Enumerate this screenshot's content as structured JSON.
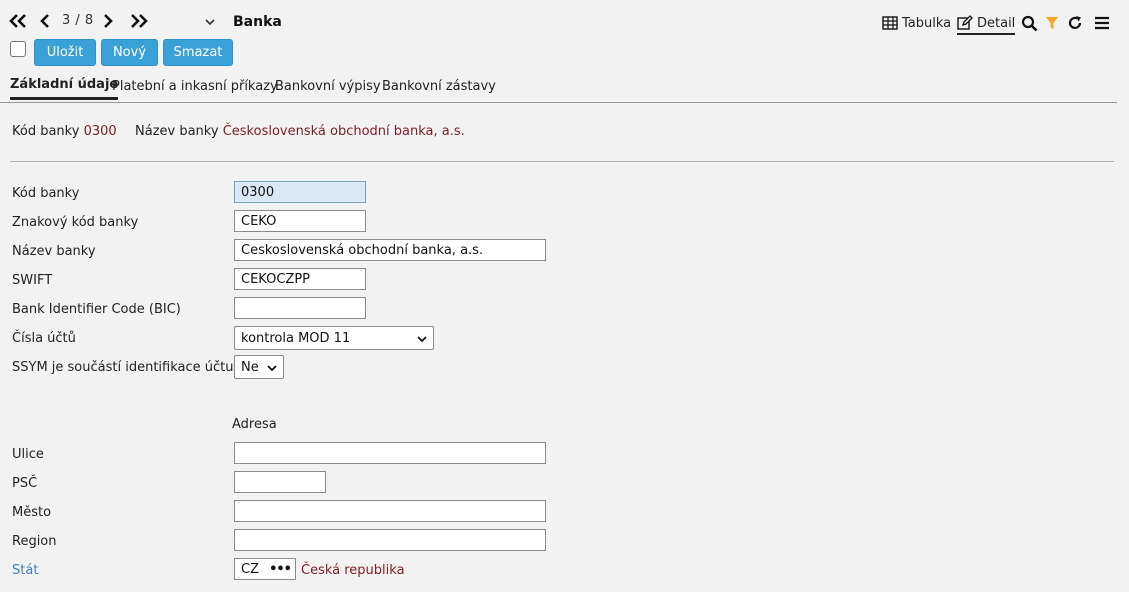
{
  "nav": {
    "position": "3 / 8",
    "title": "Banka"
  },
  "tools": {
    "table_label": "Tabulka",
    "detail_label": "Detail",
    "filter_color": "#f5a623"
  },
  "actions": {
    "save": "Uložit",
    "new": "Nový",
    "delete": "Smazat"
  },
  "tabs": [
    {
      "label": "Základní údaje"
    },
    {
      "label": "Platební a inkasní příkazy"
    },
    {
      "label": "Bankovní výpisy"
    },
    {
      "label": "Bankovní zástavy"
    }
  ],
  "summary": {
    "code_label": "Kód banky",
    "code_value": "0300",
    "name_label": "Název banky",
    "name_value": "Československá obchodní banka, a.s."
  },
  "form": {
    "kod_banky": {
      "label": "Kód banky",
      "value": "0300"
    },
    "znakovy_kod": {
      "label": "Znakový kód banky",
      "value": "CEKO"
    },
    "nazev_banky": {
      "label": "Název banky",
      "value": "Československá obchodní banka, a.s."
    },
    "swift": {
      "label": "SWIFT",
      "value": "CEKOCZPP"
    },
    "bic": {
      "label": "Bank Identifier Code (BIC)",
      "value": ""
    },
    "cisla_uctu": {
      "label": "Čísla účtů",
      "value": "kontrola MOD 11"
    },
    "ssym": {
      "label": "SSYM je součástí identifikace účtu",
      "value": "Ne"
    }
  },
  "address": {
    "title": "Adresa",
    "ulice": {
      "label": "Ulice",
      "value": ""
    },
    "psc": {
      "label": "PSČ",
      "value": ""
    },
    "mesto": {
      "label": "Město",
      "value": ""
    },
    "region": {
      "label": "Region",
      "value": ""
    },
    "stat": {
      "label": "Stát",
      "value": "CZ",
      "name": "Česká republika"
    }
  }
}
